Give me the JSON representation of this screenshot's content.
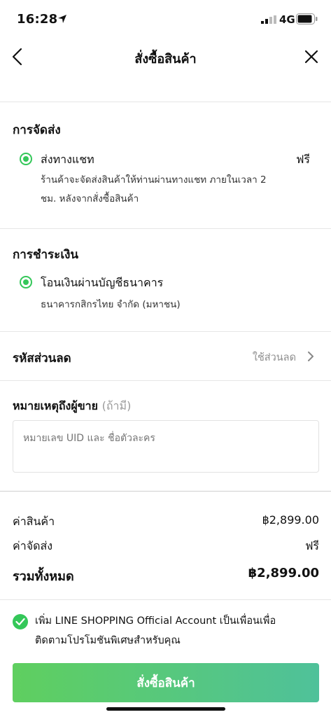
{
  "status_bar": {
    "time": "16:28",
    "network": "4G"
  },
  "nav": {
    "title": "สั่งซื้อสินค้า"
  },
  "shipping": {
    "title": "การจัดส่ง",
    "option_label": "ส่งทางแชท",
    "option_price": "ฟรี",
    "desc_line1": "ร้านค้าจะจัดส่งสินค้าให้ท่านผ่านทางแชท ภายในเวลา 2",
    "desc_line2": "ชม. หลังจากสั่งซื้อสินค้า"
  },
  "payment": {
    "title": "การชำระเงิน",
    "option_label": "โอนเงินผ่านบัญชีธนาคาร",
    "bank": "ธนาคารกสิกรไทย จำกัด (มหาชน)"
  },
  "coupon": {
    "title": "รหัสส่วนลด",
    "action": "ใช้ส่วนลด"
  },
  "note": {
    "title": "หมายเหตุถึงผู้ขาย",
    "optional": "(ถ้ามี)",
    "placeholder": "หมายเลข UID และ ชื่อตัวละคร"
  },
  "summary": {
    "subtotal_label": "ค่าสินค้า",
    "subtotal_value": "฿2,899.00",
    "shipping_label": "ค่าจัดส่ง",
    "shipping_value": "ฟรี",
    "total_label": "รวมทั้งหมด",
    "total_value": "฿2,899.00"
  },
  "oa_consent": {
    "line1": "เพิ่ม LINE SHOPPING Official Account เป็นเพื่อนเพื่อ",
    "line2": "ติดตามโปรโมชันพิเศษสำหรับคุณ",
    "checked": true
  },
  "order_button": {
    "label": "สั่งซื้อสินค้า"
  },
  "colors": {
    "accent": "#34c759",
    "button_start": "#5fcf5f",
    "button_end": "#4fc19a"
  }
}
